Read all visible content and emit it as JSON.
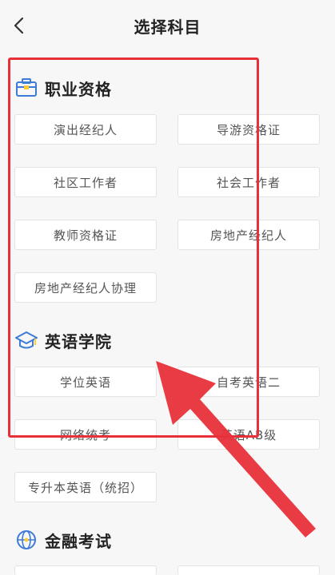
{
  "header": {
    "title": "选择科目"
  },
  "sections": [
    {
      "title": "职业资格",
      "icon": "briefcase-icon",
      "items": [
        "演出经纪人",
        "导游资格证",
        "社区工作者",
        "社会工作者",
        "教师资格证",
        "房地产经纪人",
        "房地产经纪人协理"
      ]
    },
    {
      "title": "英语学院",
      "icon": "graduation-cap-icon",
      "items": [
        "学位英语",
        "自考英语二",
        "网络统考",
        "英语AB级",
        "专升本英语（统招）"
      ]
    },
    {
      "title": "金融考试",
      "icon": "globe-icon",
      "items": []
    }
  ],
  "colors": {
    "accent_blue": "#3d7bd9",
    "highlight_red": "#e8303a"
  }
}
